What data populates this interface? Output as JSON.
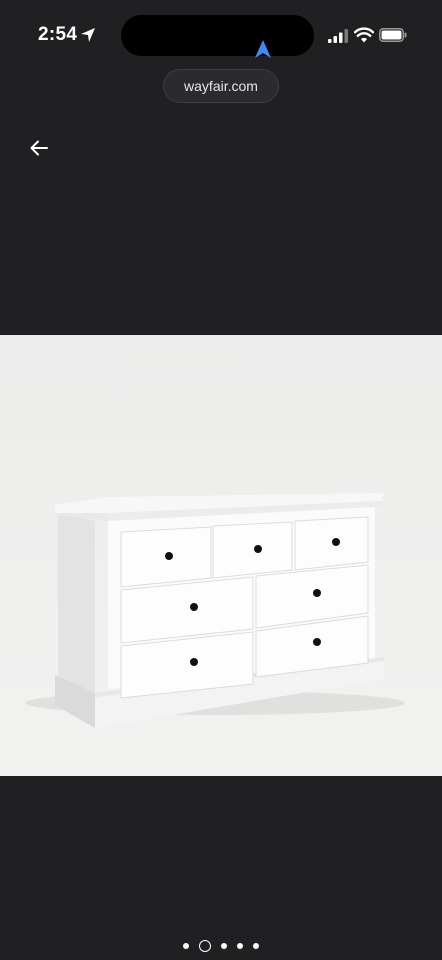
{
  "status": {
    "time": "2:54"
  },
  "browser": {
    "url": "wayfair.com"
  },
  "icons": {
    "location": "location-arrow-icon",
    "navigation": "navigation-arrow-icon",
    "signal": "cellular-signal-icon",
    "wifi": "wifi-icon",
    "battery": "battery-icon",
    "back": "back-arrow-icon"
  },
  "carousel": {
    "total_images": 5,
    "active_index": 1
  },
  "colors": {
    "background": "#201f21",
    "nav_accent": "#3b8cf5"
  }
}
